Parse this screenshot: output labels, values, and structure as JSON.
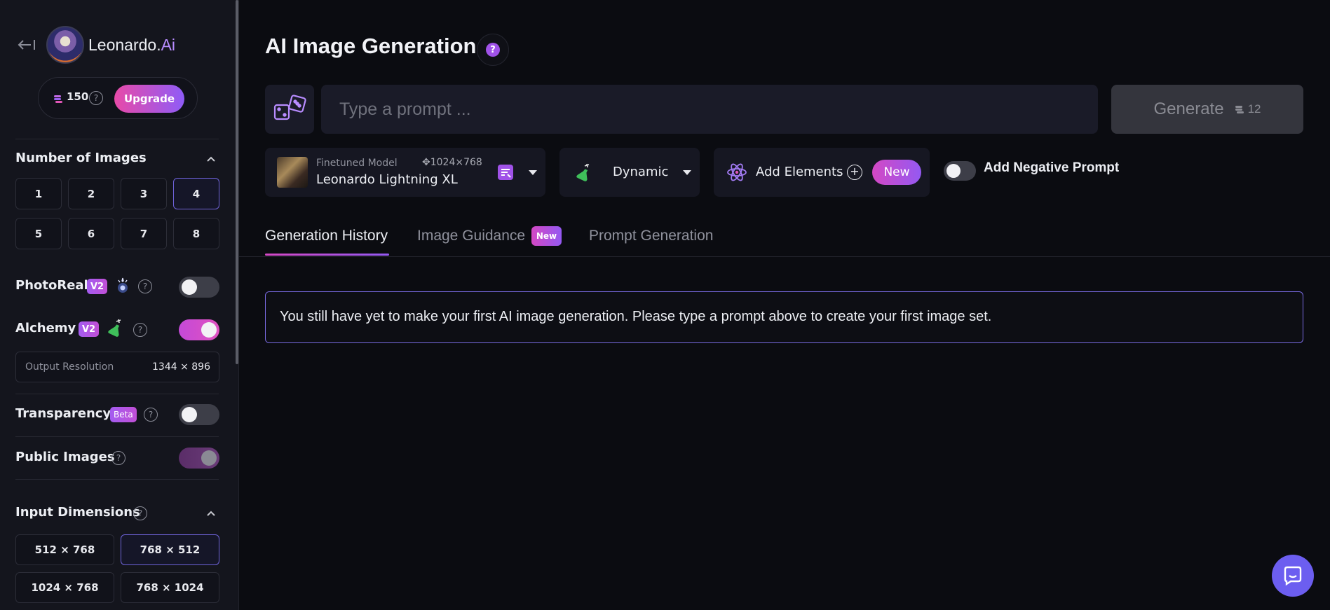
{
  "brand": {
    "name": "Leonardo.",
    "suffix": "Ai"
  },
  "account": {
    "tokens": "150",
    "upgrade_label": "Upgrade"
  },
  "sidebar": {
    "number_of_images": {
      "title": "Number of Images",
      "options": [
        "1",
        "2",
        "3",
        "4",
        "5",
        "6",
        "7",
        "8"
      ],
      "selected": "4"
    },
    "photoreal": {
      "label": "PhotoReal",
      "badge": "V2",
      "enabled": false
    },
    "alchemy": {
      "label": "Alchemy",
      "badge": "V2",
      "enabled": true
    },
    "output_resolution": {
      "label": "Output Resolution",
      "value": "1344 × 896"
    },
    "transparency": {
      "label": "Transparency",
      "badge": "Beta",
      "enabled": false
    },
    "public_images": {
      "label": "Public Images",
      "enabled": true
    },
    "input_dimensions": {
      "title": "Input Dimensions",
      "options": [
        "512 × 768",
        "768 × 512",
        "1024 × 768",
        "768 × 1024"
      ],
      "selected": "768 × 512"
    }
  },
  "main": {
    "title": "AI Image Generation",
    "prompt": {
      "placeholder": "Type a prompt ...",
      "value": ""
    },
    "generate": {
      "label": "Generate",
      "cost": "12"
    },
    "model": {
      "kind": "Finetuned Model",
      "name": "Leonardo Lightning XL",
      "size": "1024×768"
    },
    "style": {
      "label": "Dynamic"
    },
    "elements": {
      "label": "Add Elements",
      "badge": "New"
    },
    "negative_prompt": {
      "label": "Add Negative Prompt",
      "enabled": false
    },
    "tabs": [
      {
        "label": "Generation History",
        "active": true
      },
      {
        "label": "Image Guidance",
        "badge": "New",
        "active": false
      },
      {
        "label": "Prompt Generation",
        "active": false
      }
    ],
    "empty_message": "You still have yet to make your first AI image generation. Please type a prompt above to create your first image set."
  },
  "colors": {
    "accent_pink": "#d448c4",
    "accent_purple": "#9459f2",
    "fab": "#6c5ef0"
  }
}
